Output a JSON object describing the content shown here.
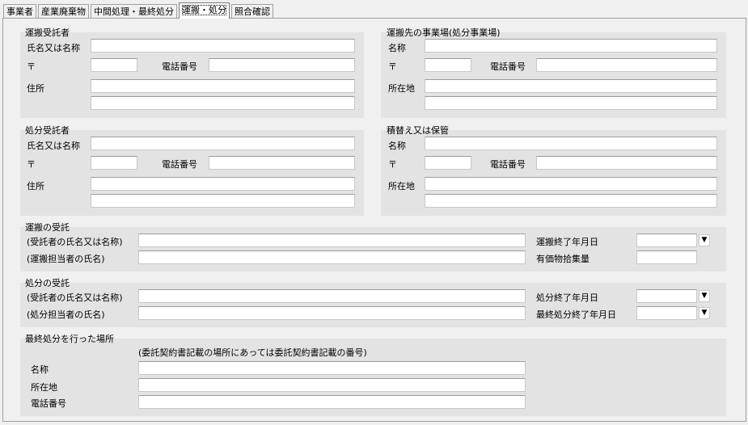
{
  "tabs": [
    "事業者",
    "産業廃棄物",
    "中間処理・最終処分",
    "運搬・処分",
    "照合確認"
  ],
  "sections": {
    "transport_contractor": {
      "title": "運搬受託者",
      "name_label": "氏名又は名称",
      "postal_label": "〒",
      "phone_label": "電話番号",
      "address_label": "住所"
    },
    "destination": {
      "title": "運搬先の事業場(処分事業場)",
      "name_label": "名称",
      "postal_label": "〒",
      "phone_label": "電話番号",
      "address_label": "所在地"
    },
    "disposal_contractor": {
      "title": "処分受託者",
      "name_label": "氏名又は名称",
      "postal_label": "〒",
      "phone_label": "電話番号",
      "address_label": "住所"
    },
    "transfer_storage": {
      "title": "積替え又は保管",
      "name_label": "名称",
      "postal_label": "〒",
      "phone_label": "電話番号",
      "address_label": "所在地"
    },
    "transport_receipt": {
      "title": "運搬の受託",
      "contractor_label": "(受託者の氏名又は名称)",
      "person_label": "(運搬担当者の氏名)",
      "end_date_label": "運搬終了年月日",
      "valuables_label": "有価物拾集量"
    },
    "disposal_receipt": {
      "title": "処分の受託",
      "contractor_label": "(受託者の氏名又は名称)",
      "person_label": "(処分担当者の氏名)",
      "end_date_label": "処分終了年月日",
      "final_end_date_label": "最終処分終了年月日"
    },
    "final_site": {
      "title": "最終処分を行った場所",
      "note": "(委託契約書記載の場所にあっては委託契約書記載の番号)",
      "name_label": "名称",
      "address_label": "所在地",
      "phone_label": "電話番号"
    }
  },
  "dropdown_glyph": "▼"
}
